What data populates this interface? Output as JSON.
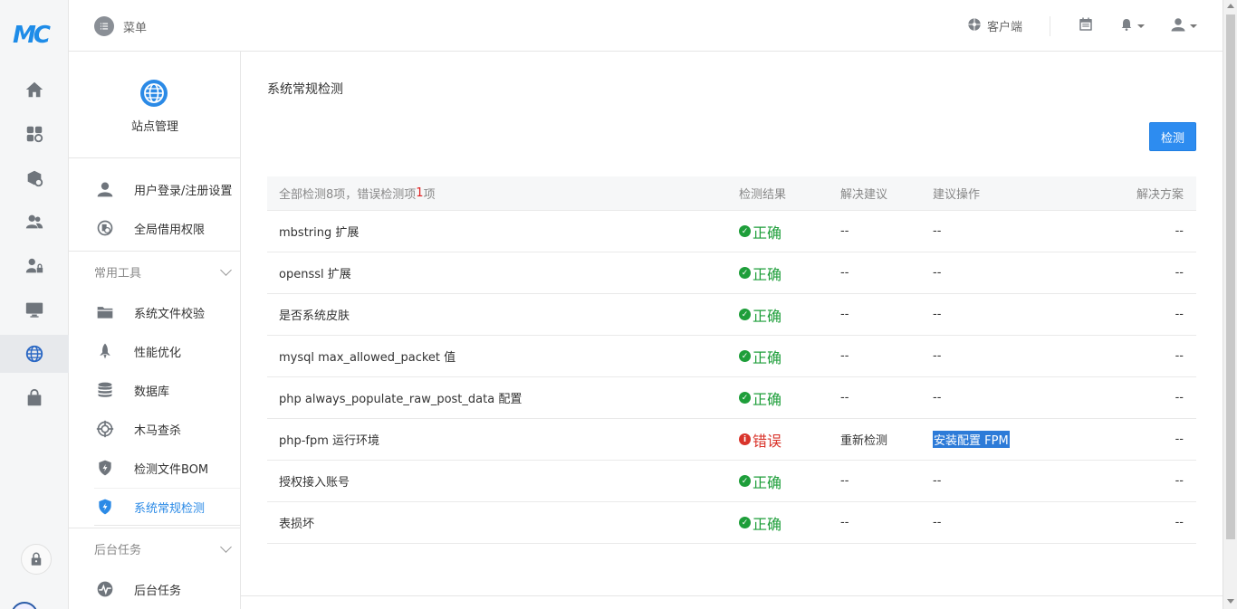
{
  "header": {
    "menu_label": "菜单",
    "client_label": "客户端"
  },
  "sidebar": {
    "title": "站点管理",
    "items_top": [
      {
        "label": "用户登录/注册设置",
        "icon": "user-icon"
      },
      {
        "label": "全局借用权限",
        "icon": "permission-icon"
      }
    ],
    "group_tools": "常用工具",
    "items_tools": [
      {
        "label": "系统文件校验",
        "icon": "folder-icon"
      },
      {
        "label": "性能优化",
        "icon": "rocket-icon"
      },
      {
        "label": "数据库",
        "icon": "database-icon"
      },
      {
        "label": "木马查杀",
        "icon": "target-icon"
      },
      {
        "label": "检测文件BOM",
        "icon": "shield-icon"
      },
      {
        "label": "系统常规检测",
        "icon": "shield-bolt-icon",
        "active": true
      }
    ],
    "group_tasks": "后台任务",
    "items_tasks": [
      {
        "label": "后台任务",
        "icon": "pulse-icon"
      }
    ]
  },
  "main": {
    "title": "系统常规检测",
    "detect_button": "检测",
    "summary_prefix": "全部检测8项，错误检测项",
    "summary_error_count": "1",
    "summary_suffix": "项",
    "columns": [
      "检测结果",
      "解决建议",
      "建议操作",
      "解决方案"
    ],
    "rows": [
      {
        "name": "mbstring 扩展",
        "status": "ok",
        "result": "正确",
        "advice": "--",
        "action": "--",
        "solution": "--"
      },
      {
        "name": "openssl 扩展",
        "status": "ok",
        "result": "正确",
        "advice": "--",
        "action": "--",
        "solution": "--"
      },
      {
        "name": "是否系统皮肤",
        "status": "ok",
        "result": "正确",
        "advice": "--",
        "action": "--",
        "solution": "--"
      },
      {
        "name": "mysql max_allowed_packet 值",
        "status": "ok",
        "result": "正确",
        "advice": "--",
        "action": "--",
        "solution": "--"
      },
      {
        "name": "php always_populate_raw_post_data 配置",
        "status": "ok",
        "result": "正确",
        "advice": "--",
        "action": "--",
        "solution": "--"
      },
      {
        "name": "php-fpm 运行环境",
        "status": "error",
        "result": "错误",
        "advice": "重新检测",
        "action": "安装配置 FPM",
        "solution": "--"
      },
      {
        "name": "授权接入账号",
        "status": "ok",
        "result": "正确",
        "advice": "--",
        "action": "--",
        "solution": "--"
      },
      {
        "name": "表损坏",
        "status": "ok",
        "result": "正确",
        "advice": "--",
        "action": "--",
        "solution": "--"
      }
    ]
  },
  "colors": {
    "accent": "#2d8cf0",
    "ok": "#1e9e3a",
    "error": "#d9342b"
  }
}
